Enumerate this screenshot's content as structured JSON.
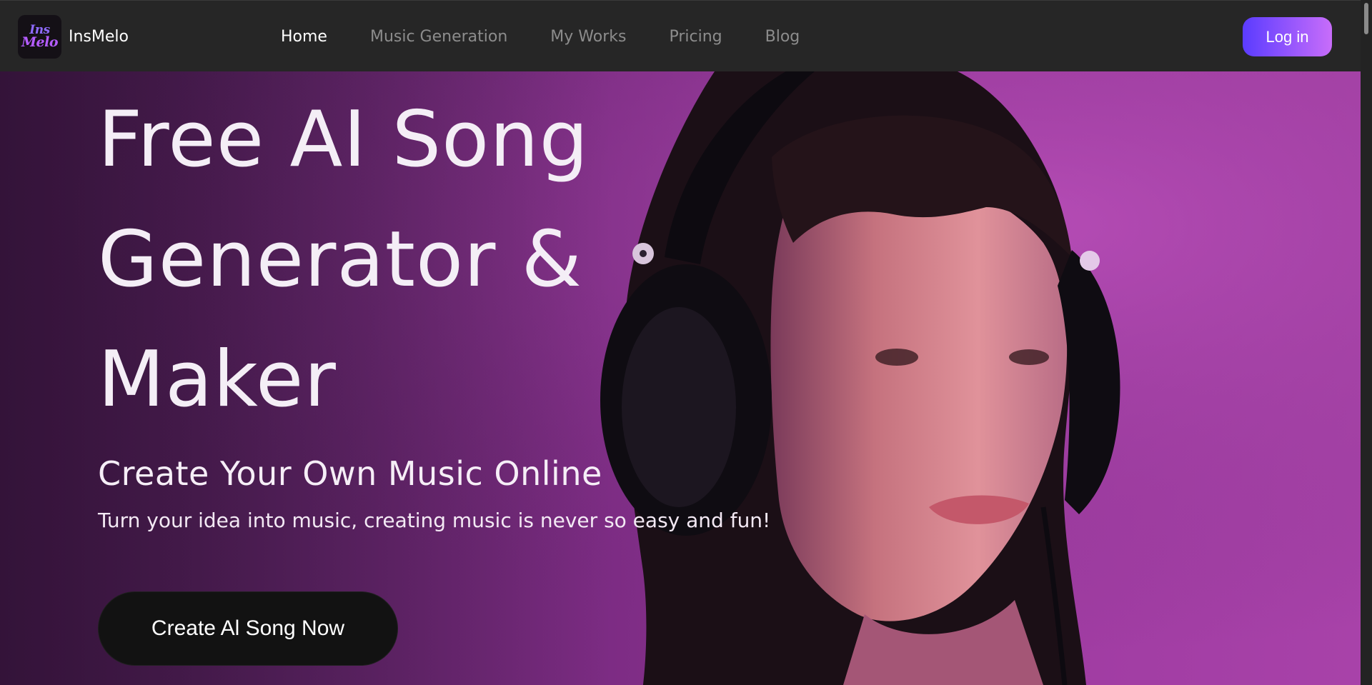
{
  "brand": {
    "logo_line1": "Ins",
    "logo_line2": "Melo",
    "name": "InsMelo"
  },
  "nav": {
    "items": [
      {
        "label": "Home",
        "active": true
      },
      {
        "label": "Music Generation",
        "active": false
      },
      {
        "label": "My Works",
        "active": false
      },
      {
        "label": "Pricing",
        "active": false
      },
      {
        "label": "Blog",
        "active": false
      }
    ],
    "login_label": "Log in"
  },
  "hero": {
    "title": "Free AI Song\nGenerator &\nMaker",
    "subtitle": "Create Your Own Music Online",
    "description": "Turn your idea into music, creating music is never so easy and fun!",
    "cta_label": "Create Al Song Now"
  },
  "colors": {
    "navbar_bg": "#262626",
    "hero_bg_left": "#3f1846",
    "hero_bg_right": "#a842a9",
    "login_gradient_start": "#5b3cff",
    "login_gradient_end": "#c86dfa",
    "cta_bg": "#121212",
    "text_primary": "#ffffff",
    "text_muted": "#8c8c8c"
  },
  "icons": {
    "logo": "insmelo-logo-icon",
    "hero_image": "woman-with-headphones-image"
  }
}
